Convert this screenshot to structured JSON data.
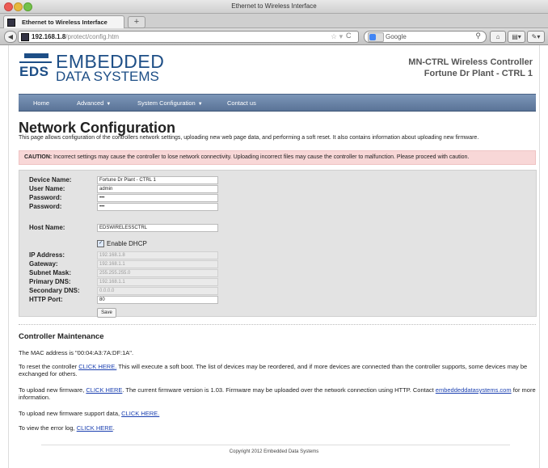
{
  "browser": {
    "window_title": "Ethernet to Wireless Interface",
    "tab_label": "Ethernet to Wireless Interface",
    "new_tab": "+",
    "url_host": "192.168.1.8",
    "url_path": "/protect/config.htm",
    "search_placeholder": "Google"
  },
  "header": {
    "logo_mark": "EDS",
    "logo_line1": "EMBEDDED",
    "logo_line2": "DATA SYSTEMS",
    "controller_line1": "MN-CTRL Wireless Controller",
    "controller_line2": "Fortune Dr Plant - CTRL 1"
  },
  "menu": {
    "items": [
      {
        "label": "Home"
      },
      {
        "label": "Advanced"
      },
      {
        "label": "System Configuration"
      },
      {
        "label": "Contact us"
      }
    ],
    "dropdown_caret": "▼"
  },
  "content": {
    "title": "Network Configuration",
    "description": "This page allows configuration of the controllers network settings, uploading new web page data, and performing a soft reset. It also contains information about uploading new firmware.",
    "caution_label": "CAUTION:",
    "caution_text": " Incorrect settings may cause the controller to lose network connectivity. Uploading incorrect files may cause the controller to malfunction. Please proceed with caution."
  },
  "form": {
    "device_name_label": "Device Name:",
    "device_name_value": "Fortune Dr Plant - CTRL 1",
    "user_name_label": "User Name:",
    "user_name_value": "admin",
    "password_label": "Password:",
    "password_value": "•••",
    "password2_label": "Password:",
    "password2_value": "•••",
    "host_name_label": "Host Name:",
    "host_name_value": "EDSWIRELESSCTRL",
    "dhcp_label": "Enable DHCP",
    "dhcp_checked": "✓",
    "ip_label": "IP Address:",
    "ip_value": "192.168.1.8",
    "gateway_label": "Gateway:",
    "gateway_value": "192.168.1.1",
    "subnet_label": "Subnet Mask:",
    "subnet_value": "255.255.255.0",
    "dns1_label": "Primary DNS:",
    "dns1_value": "192.168.1.1",
    "dns2_label": "Secondary DNS:",
    "dns2_value": "0.0.0.0",
    "http_label": "HTTP Port:",
    "http_value": "80",
    "save_label": "Save"
  },
  "maintenance": {
    "title": "Controller Maintenance",
    "mac_text": "The MAC address is \"00:04:A3:7A:DF:1A\".",
    "reset_pre": "To reset the controller ",
    "reset_link": "CLICK HERE.",
    "reset_post": " This will execute a soft boot. The list of devices may be reordered, and if more devices are connected than the controller supports, some devices may be exchanged for others.",
    "fw_pre": "To upload new firmware, ",
    "fw_link": "CLICK HERE",
    "fw_post": ". The current firmware version is 1.03. Firmware may be uploaded over the network connection using HTTP. Contact ",
    "fw_contact": "embeddeddatasystems.com",
    "fw_end": " for more information.",
    "support_pre": "To upload new firmware support data, ",
    "support_link": "CLICK HERE.",
    "errlog_pre": "To view the error log, ",
    "errlog_link": "CLICK HERE",
    "errlog_post": "."
  },
  "footer": {
    "copyright": "Copyright 2012 Embedded Data Systems"
  }
}
